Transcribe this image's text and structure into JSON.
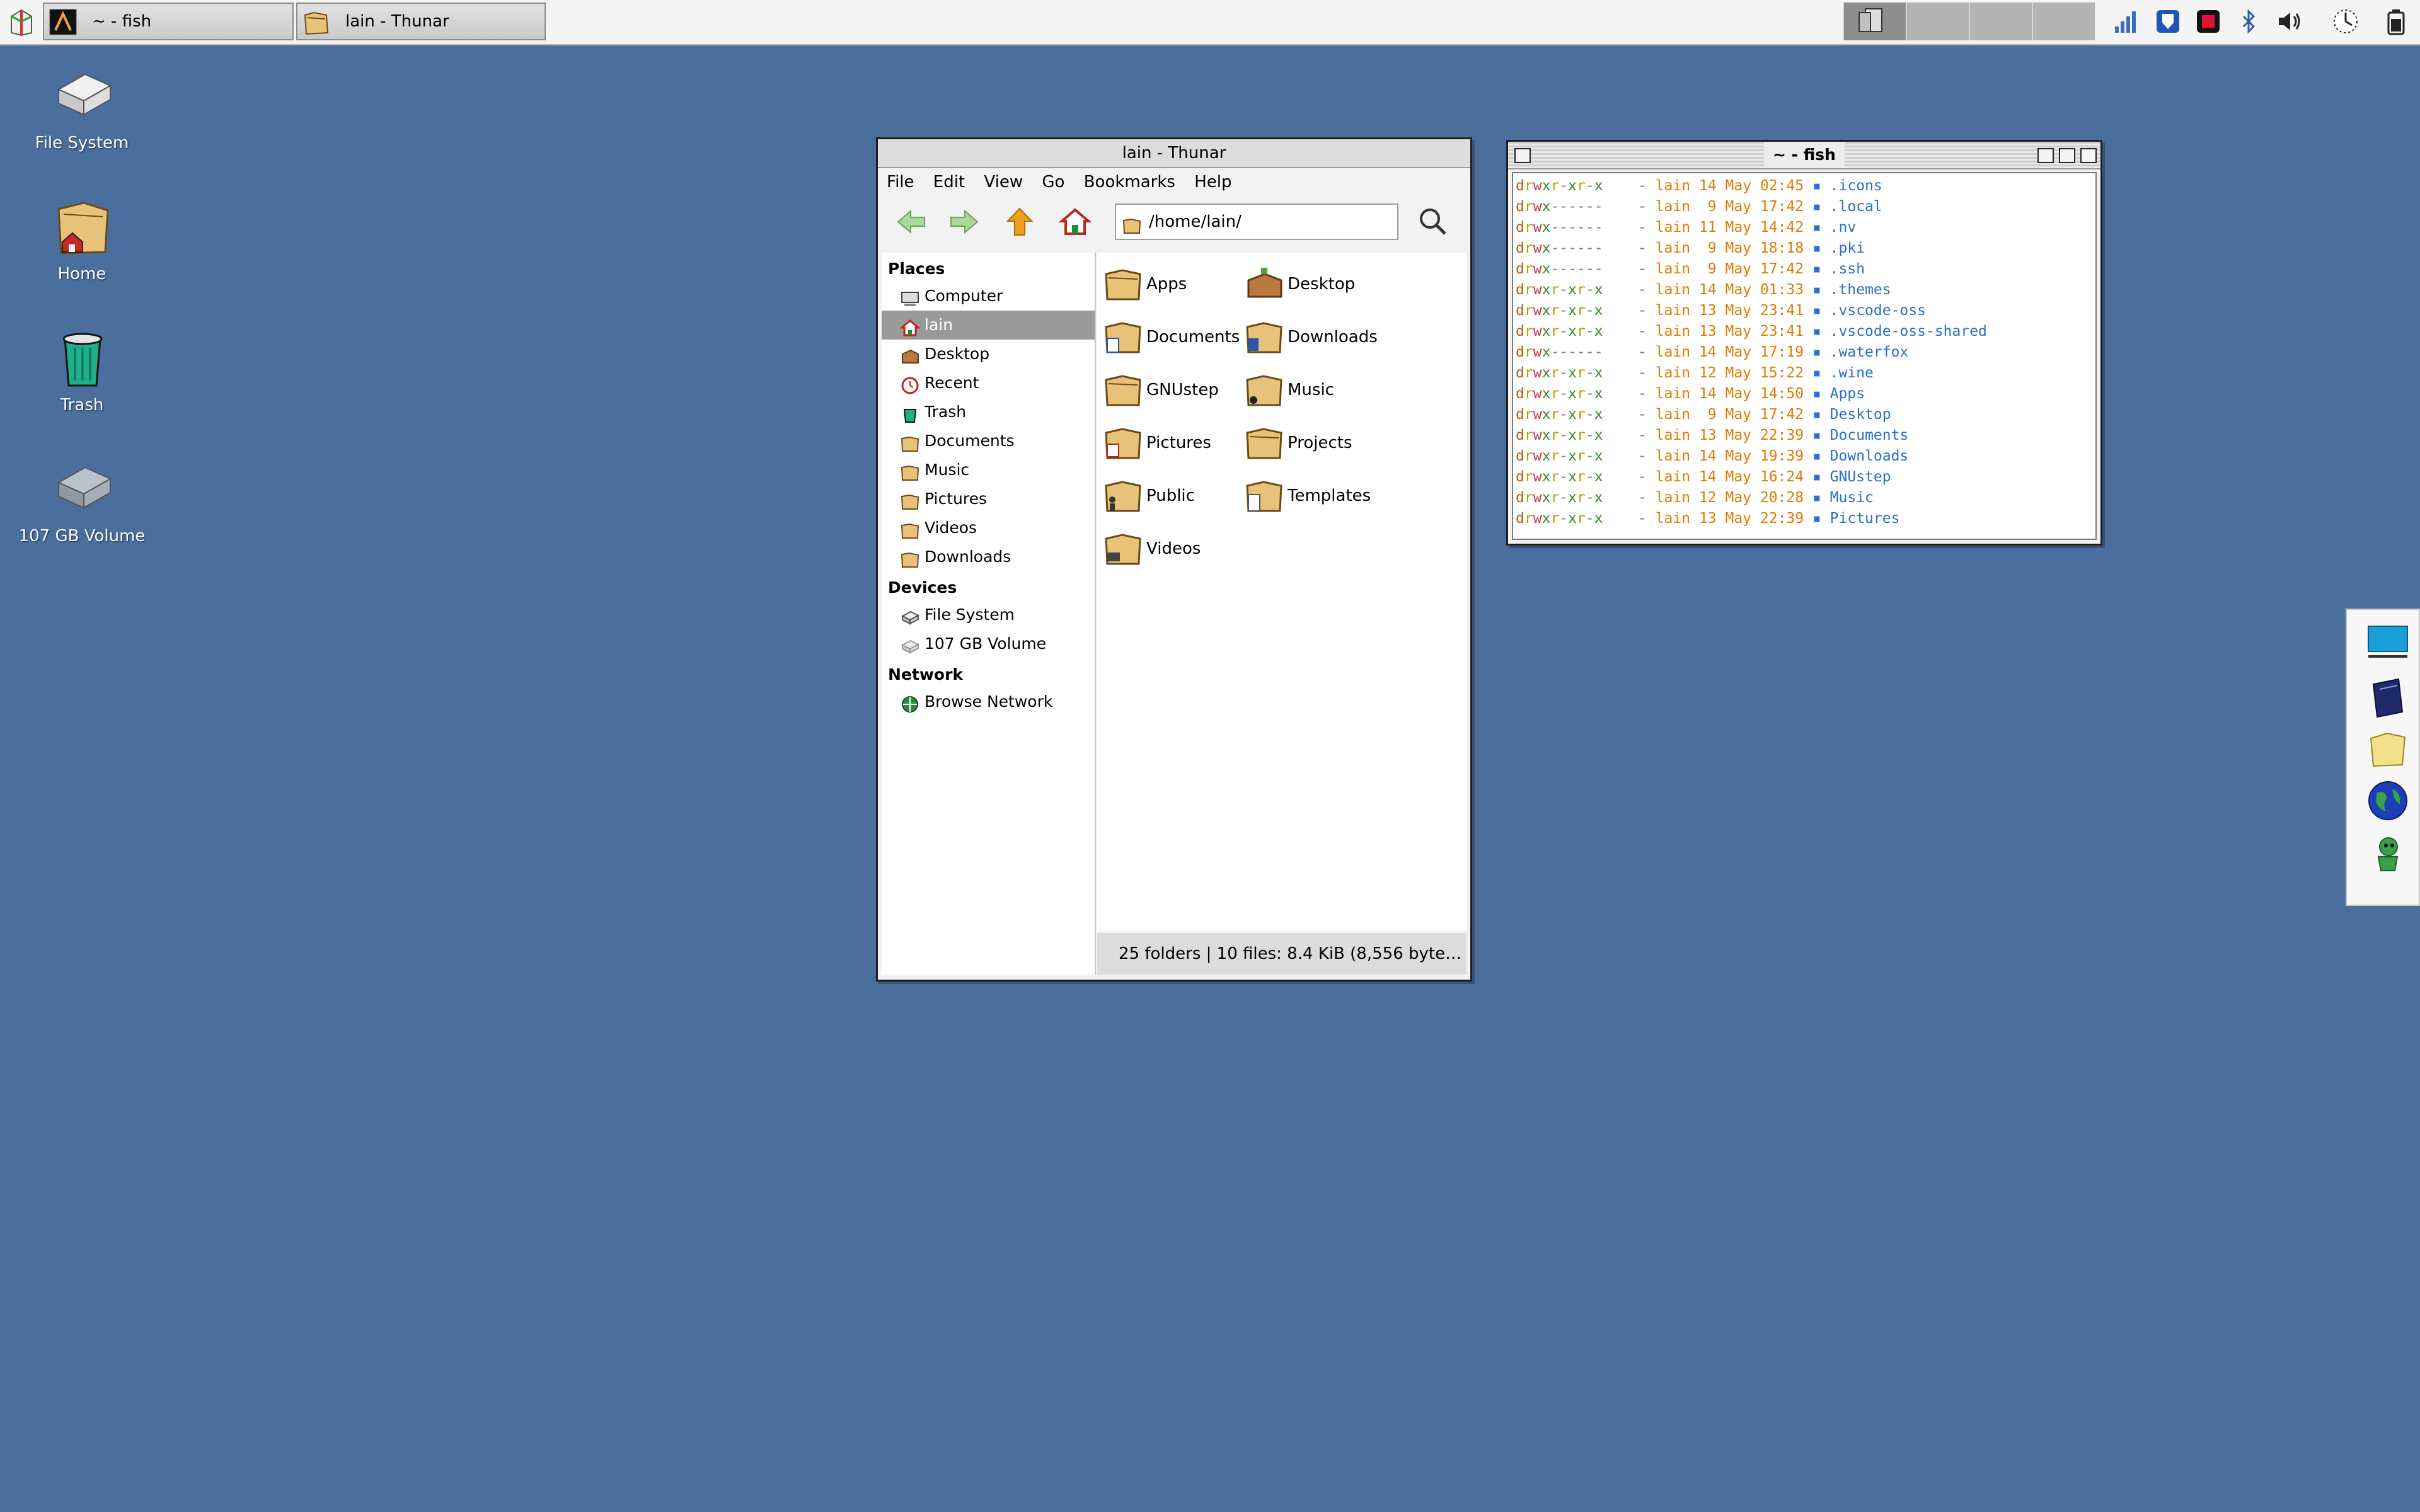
{
  "panel": {
    "tasks": [
      {
        "title": "~ - fish",
        "icon": "terminal-icon"
      },
      {
        "title": "lain - Thunar",
        "icon": "file-manager-icon"
      }
    ],
    "tray_icons": [
      "network-signal-icon",
      "bitwarden-icon",
      "record-icon",
      "bluetooth-icon",
      "volume-icon",
      "clock-icon",
      "battery-icon"
    ]
  },
  "desktop_icons": [
    {
      "label": "File System",
      "icon": "hard-drive-icon"
    },
    {
      "label": "Home",
      "icon": "home-folder-icon"
    },
    {
      "label": "Trash",
      "icon": "trash-icon"
    },
    {
      "label": "107 GB Volume",
      "icon": "volume-drive-icon"
    }
  ],
  "thunar": {
    "title": "lain - Thunar",
    "menu": [
      "File",
      "Edit",
      "View",
      "Go",
      "Bookmarks",
      "Help"
    ],
    "path": "/home/lain/",
    "sections": {
      "places": "Places",
      "devices": "Devices",
      "network": "Network"
    },
    "places": [
      {
        "label": "Computer",
        "icon": "computer-icon"
      },
      {
        "label": "lain",
        "icon": "home-icon"
      },
      {
        "label": "Desktop",
        "icon": "desktop-icon"
      },
      {
        "label": "Recent",
        "icon": "recent-icon"
      },
      {
        "label": "Trash",
        "icon": "trash-icon"
      },
      {
        "label": "Documents",
        "icon": "folder-icon"
      },
      {
        "label": "Music",
        "icon": "folder-icon"
      },
      {
        "label": "Pictures",
        "icon": "folder-icon"
      },
      {
        "label": "Videos",
        "icon": "folder-icon"
      },
      {
        "label": "Downloads",
        "icon": "folder-icon"
      }
    ],
    "devices": [
      {
        "label": "File System",
        "icon": "drive-icon"
      },
      {
        "label": "107 GB Volume",
        "icon": "drive-icon"
      }
    ],
    "network": [
      {
        "label": "Browse Network",
        "icon": "network-icon"
      }
    ],
    "files": [
      "Apps",
      "Desktop",
      "Documents",
      "Downloads",
      "GNUstep",
      "Music",
      "Pictures",
      "Projects",
      "Public",
      "Templates",
      "Videos"
    ],
    "status": "25 folders  |  10 files: 8.4 KiB (8,556 byte…"
  },
  "terminal": {
    "title": "~ - fish",
    "rows": [
      {
        "perm": "drwxr-xr-x",
        "user": "lain",
        "date": "14 May 02:45",
        "name": ".icons"
      },
      {
        "perm": "drwx------",
        "user": "lain",
        "date": " 9 May 17:42",
        "name": ".local"
      },
      {
        "perm": "drwx------",
        "user": "lain",
        "date": "11 May 14:42",
        "name": ".nv"
      },
      {
        "perm": "drwx------",
        "user": "lain",
        "date": " 9 May 18:18",
        "name": ".pki"
      },
      {
        "perm": "drwx------",
        "user": "lain",
        "date": " 9 May 17:42",
        "name": ".ssh"
      },
      {
        "perm": "drwxr-xr-x",
        "user": "lain",
        "date": "14 May 01:33",
        "name": ".themes"
      },
      {
        "perm": "drwxr-xr-x",
        "user": "lain",
        "date": "13 May 23:41",
        "name": ".vscode-oss"
      },
      {
        "perm": "drwxr-xr-x",
        "user": "lain",
        "date": "13 May 23:41",
        "name": ".vscode-oss-shared"
      },
      {
        "perm": "drwx------",
        "user": "lain",
        "date": "14 May 17:19",
        "name": ".waterfox"
      },
      {
        "perm": "drwxr-xr-x",
        "user": "lain",
        "date": "12 May 15:22",
        "name": ".wine"
      },
      {
        "perm": "drwxr-xr-x",
        "user": "lain",
        "date": "14 May 14:50",
        "name": "Apps"
      },
      {
        "perm": "drwxr-xr-x",
        "user": "lain",
        "date": " 9 May 17:42",
        "name": "Desktop"
      },
      {
        "perm": "drwxr-xr-x",
        "user": "lain",
        "date": "13 May 22:39",
        "name": "Documents"
      },
      {
        "perm": "drwxr-xr-x",
        "user": "lain",
        "date": "14 May 19:39",
        "name": "Downloads"
      },
      {
        "perm": "drwxr-xr-x",
        "user": "lain",
        "date": "14 May 16:24",
        "name": "GNUstep"
      },
      {
        "perm": "drwxr-xr-x",
        "user": "lain",
        "date": "12 May 20:28",
        "name": "Music"
      },
      {
        "perm": "drwxr-xr-x",
        "user": "lain",
        "date": "13 May 22:39",
        "name": "Pictures"
      }
    ]
  },
  "dock": [
    "terminal-app-icon",
    "notebook-app-icon",
    "folder-app-icon",
    "globe-app-icon",
    "gnu-app-icon"
  ],
  "colors": {
    "desktop": "#4b6f9d",
    "folder": "#e9c27a",
    "selection": "#9a9a9a"
  }
}
